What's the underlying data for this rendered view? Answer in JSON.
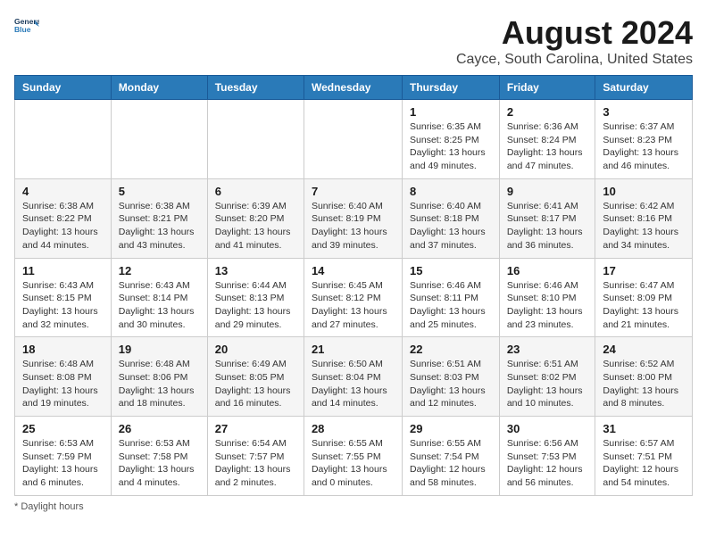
{
  "app": {
    "logo_line1": "General",
    "logo_line2": "Blue"
  },
  "header": {
    "month_year": "August 2024",
    "location": "Cayce, South Carolina, United States"
  },
  "weekdays": [
    "Sunday",
    "Monday",
    "Tuesday",
    "Wednesday",
    "Thursday",
    "Friday",
    "Saturday"
  ],
  "footer": {
    "note": "Daylight hours"
  },
  "weeks": [
    {
      "days": [
        {
          "num": "",
          "info": ""
        },
        {
          "num": "",
          "info": ""
        },
        {
          "num": "",
          "info": ""
        },
        {
          "num": "",
          "info": ""
        },
        {
          "num": "1",
          "info": "Sunrise: 6:35 AM\nSunset: 8:25 PM\nDaylight: 13 hours and 49 minutes."
        },
        {
          "num": "2",
          "info": "Sunrise: 6:36 AM\nSunset: 8:24 PM\nDaylight: 13 hours and 47 minutes."
        },
        {
          "num": "3",
          "info": "Sunrise: 6:37 AM\nSunset: 8:23 PM\nDaylight: 13 hours and 46 minutes."
        }
      ]
    },
    {
      "days": [
        {
          "num": "4",
          "info": "Sunrise: 6:38 AM\nSunset: 8:22 PM\nDaylight: 13 hours and 44 minutes."
        },
        {
          "num": "5",
          "info": "Sunrise: 6:38 AM\nSunset: 8:21 PM\nDaylight: 13 hours and 43 minutes."
        },
        {
          "num": "6",
          "info": "Sunrise: 6:39 AM\nSunset: 8:20 PM\nDaylight: 13 hours and 41 minutes."
        },
        {
          "num": "7",
          "info": "Sunrise: 6:40 AM\nSunset: 8:19 PM\nDaylight: 13 hours and 39 minutes."
        },
        {
          "num": "8",
          "info": "Sunrise: 6:40 AM\nSunset: 8:18 PM\nDaylight: 13 hours and 37 minutes."
        },
        {
          "num": "9",
          "info": "Sunrise: 6:41 AM\nSunset: 8:17 PM\nDaylight: 13 hours and 36 minutes."
        },
        {
          "num": "10",
          "info": "Sunrise: 6:42 AM\nSunset: 8:16 PM\nDaylight: 13 hours and 34 minutes."
        }
      ]
    },
    {
      "days": [
        {
          "num": "11",
          "info": "Sunrise: 6:43 AM\nSunset: 8:15 PM\nDaylight: 13 hours and 32 minutes."
        },
        {
          "num": "12",
          "info": "Sunrise: 6:43 AM\nSunset: 8:14 PM\nDaylight: 13 hours and 30 minutes."
        },
        {
          "num": "13",
          "info": "Sunrise: 6:44 AM\nSunset: 8:13 PM\nDaylight: 13 hours and 29 minutes."
        },
        {
          "num": "14",
          "info": "Sunrise: 6:45 AM\nSunset: 8:12 PM\nDaylight: 13 hours and 27 minutes."
        },
        {
          "num": "15",
          "info": "Sunrise: 6:46 AM\nSunset: 8:11 PM\nDaylight: 13 hours and 25 minutes."
        },
        {
          "num": "16",
          "info": "Sunrise: 6:46 AM\nSunset: 8:10 PM\nDaylight: 13 hours and 23 minutes."
        },
        {
          "num": "17",
          "info": "Sunrise: 6:47 AM\nSunset: 8:09 PM\nDaylight: 13 hours and 21 minutes."
        }
      ]
    },
    {
      "days": [
        {
          "num": "18",
          "info": "Sunrise: 6:48 AM\nSunset: 8:08 PM\nDaylight: 13 hours and 19 minutes."
        },
        {
          "num": "19",
          "info": "Sunrise: 6:48 AM\nSunset: 8:06 PM\nDaylight: 13 hours and 18 minutes."
        },
        {
          "num": "20",
          "info": "Sunrise: 6:49 AM\nSunset: 8:05 PM\nDaylight: 13 hours and 16 minutes."
        },
        {
          "num": "21",
          "info": "Sunrise: 6:50 AM\nSunset: 8:04 PM\nDaylight: 13 hours and 14 minutes."
        },
        {
          "num": "22",
          "info": "Sunrise: 6:51 AM\nSunset: 8:03 PM\nDaylight: 13 hours and 12 minutes."
        },
        {
          "num": "23",
          "info": "Sunrise: 6:51 AM\nSunset: 8:02 PM\nDaylight: 13 hours and 10 minutes."
        },
        {
          "num": "24",
          "info": "Sunrise: 6:52 AM\nSunset: 8:00 PM\nDaylight: 13 hours and 8 minutes."
        }
      ]
    },
    {
      "days": [
        {
          "num": "25",
          "info": "Sunrise: 6:53 AM\nSunset: 7:59 PM\nDaylight: 13 hours and 6 minutes."
        },
        {
          "num": "26",
          "info": "Sunrise: 6:53 AM\nSunset: 7:58 PM\nDaylight: 13 hours and 4 minutes."
        },
        {
          "num": "27",
          "info": "Sunrise: 6:54 AM\nSunset: 7:57 PM\nDaylight: 13 hours and 2 minutes."
        },
        {
          "num": "28",
          "info": "Sunrise: 6:55 AM\nSunset: 7:55 PM\nDaylight: 13 hours and 0 minutes."
        },
        {
          "num": "29",
          "info": "Sunrise: 6:55 AM\nSunset: 7:54 PM\nDaylight: 12 hours and 58 minutes."
        },
        {
          "num": "30",
          "info": "Sunrise: 6:56 AM\nSunset: 7:53 PM\nDaylight: 12 hours and 56 minutes."
        },
        {
          "num": "31",
          "info": "Sunrise: 6:57 AM\nSunset: 7:51 PM\nDaylight: 12 hours and 54 minutes."
        }
      ]
    }
  ]
}
